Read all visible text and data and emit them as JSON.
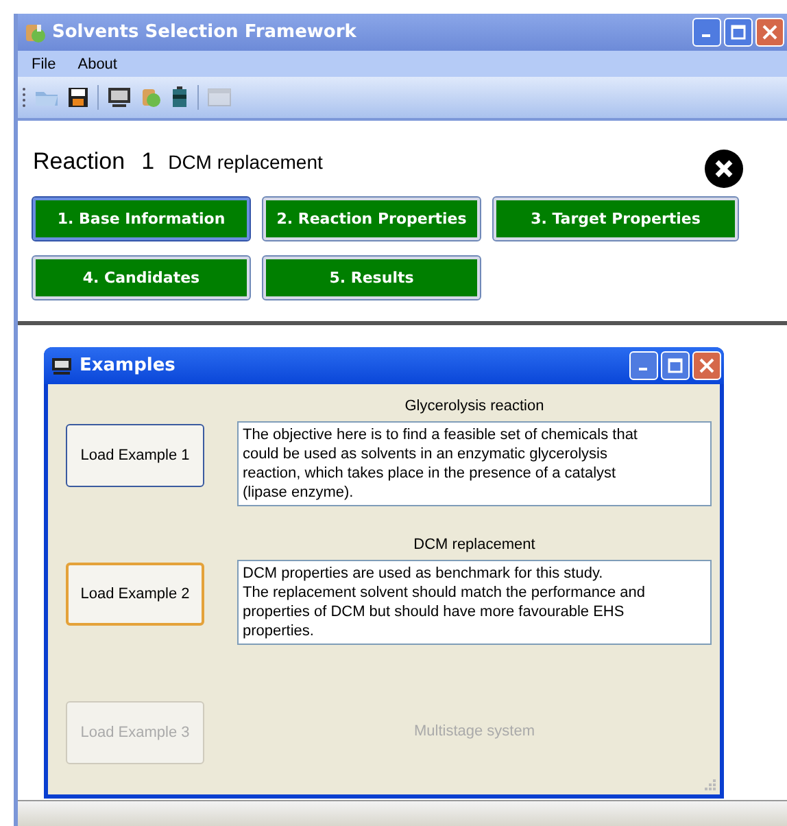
{
  "window": {
    "title": "Solvents Selection Framework"
  },
  "menu": [
    "File",
    "About"
  ],
  "reaction": {
    "label": "Reaction",
    "number": "1",
    "name": "DCM replacement"
  },
  "steps": [
    {
      "label": "1. Base Information",
      "selected": true
    },
    {
      "label": "2. Reaction Properties",
      "selected": false
    },
    {
      "label": "3. Target Properties",
      "selected": false
    },
    {
      "label": "4. Candidates",
      "selected": false
    },
    {
      "label": "5. Results",
      "selected": false
    }
  ],
  "dialog": {
    "title": "Examples",
    "examples": [
      {
        "button": "Load Example 1",
        "focused": false,
        "disabled": false,
        "title": "Glycerolysis reaction",
        "description": "The objective here is to find a feasible set of chemicals that could be used as solvents in an enzymatic glycerolysis reaction, which takes place in the presence of a catalyst (lipase enzyme)."
      },
      {
        "button": "Load Example 2",
        "focused": true,
        "disabled": false,
        "title": "DCM replacement",
        "description": "DCM properties are used as benchmark for this study.\nThe replacement solvent should match the performance and properties of DCM but should have more favourable EHS properties."
      },
      {
        "button": "Load Example 3",
        "focused": false,
        "disabled": true,
        "title": "Multistage system"
      }
    ]
  }
}
